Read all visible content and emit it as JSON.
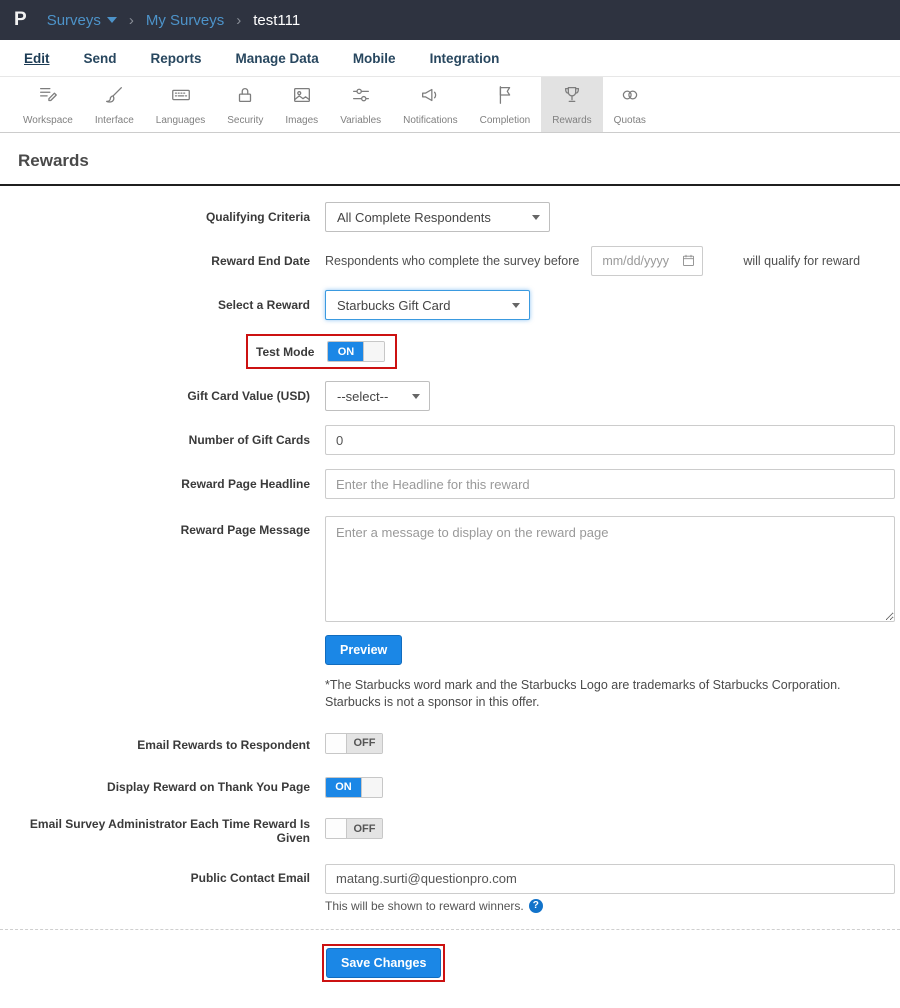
{
  "topbar": {
    "logo_text": "P",
    "sep": "›",
    "surveys_label": "Surveys",
    "my_surveys_label": "My Surveys",
    "current_label": "test111"
  },
  "tabs": {
    "items": [
      {
        "label": "Edit",
        "active": true
      },
      {
        "label": "Send"
      },
      {
        "label": "Reports"
      },
      {
        "label": "Manage Data"
      },
      {
        "label": "Mobile"
      },
      {
        "label": "Integration"
      }
    ]
  },
  "toolbar": {
    "items": [
      {
        "label": "Workspace"
      },
      {
        "label": "Interface"
      },
      {
        "label": "Languages"
      },
      {
        "label": "Security"
      },
      {
        "label": "Images"
      },
      {
        "label": "Variables"
      },
      {
        "label": "Notifications"
      },
      {
        "label": "Completion"
      },
      {
        "label": "Rewards",
        "active": true
      },
      {
        "label": "Quotas"
      }
    ]
  },
  "page": {
    "title": "Rewards"
  },
  "form": {
    "qualifying_criteria": {
      "label": "Qualifying Criteria",
      "value": "All Complete Respondents"
    },
    "reward_end_date": {
      "label": "Reward End Date",
      "prefix": "Respondents who complete the survey before",
      "date_placeholder": "mm/dd/yyyy",
      "suffix": "will qualify for reward"
    },
    "select_reward": {
      "label": "Select a Reward",
      "value": "Starbucks Gift Card"
    },
    "test_mode": {
      "label": "Test Mode",
      "state": "ON"
    },
    "gift_card_value": {
      "label": "Gift Card Value (USD)",
      "value": "--select--"
    },
    "number_of_gift_cards": {
      "label": "Number of Gift Cards",
      "value": "0"
    },
    "reward_page_headline": {
      "label": "Reward Page Headline",
      "placeholder": "Enter the Headline for this reward"
    },
    "reward_page_message": {
      "label": "Reward Page Message",
      "placeholder": "Enter a message to display on the reward page"
    },
    "preview_label": "Preview",
    "disclaimer": "*The Starbucks word mark and the Starbucks Logo are trademarks of Starbucks Corporation. Starbucks is not a sponsor in this offer.",
    "email_rewards": {
      "label": "Email Rewards to Respondent",
      "state": "OFF"
    },
    "display_reward": {
      "label": "Display Reward on Thank You Page",
      "state": "ON"
    },
    "email_admin": {
      "label": "Email Survey Administrator Each Time Reward Is Given",
      "state": "OFF"
    },
    "public_contact_email": {
      "label": "Public Contact Email",
      "value": "matang.surti@questionpro.com",
      "helper": "This will be shown to reward winners.",
      "help_icon": "?"
    },
    "save_label": "Save Changes"
  },
  "colors": {
    "accent": "#1b87e6",
    "annotation_red": "#cc1111",
    "topbar_bg": "#2e3340"
  }
}
